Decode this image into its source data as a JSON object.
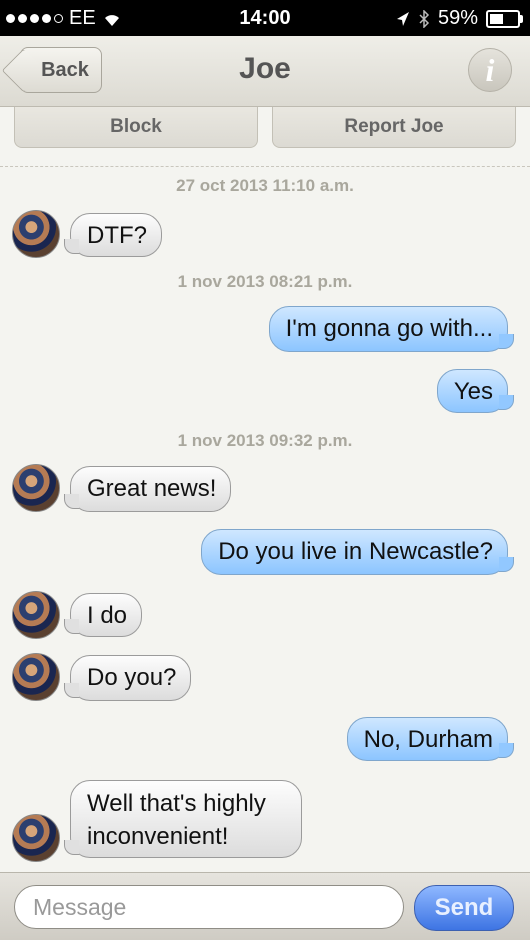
{
  "status_bar": {
    "carrier": "EE",
    "time": "14:00",
    "battery": "59%",
    "battery_level": 0.59
  },
  "nav": {
    "back_label": "Back",
    "title": "Joe",
    "info_label": "i"
  },
  "actions": {
    "block_label": "Block",
    "report_label": "Report Joe"
  },
  "messages": [
    {
      "type": "timestamp",
      "text": "27 oct 2013 11:10 a.m."
    },
    {
      "type": "in",
      "text": "DTF?"
    },
    {
      "type": "timestamp",
      "text": "1 nov 2013 08:21 p.m."
    },
    {
      "type": "out",
      "text": "I'm gonna go with..."
    },
    {
      "type": "out",
      "text": "Yes"
    },
    {
      "type": "timestamp",
      "text": "1 nov 2013 09:32 p.m."
    },
    {
      "type": "in",
      "text": "Great news!"
    },
    {
      "type": "out",
      "text": "Do you live in Newcastle?"
    },
    {
      "type": "in",
      "text": "I do"
    },
    {
      "type": "in",
      "text": "Do you?"
    },
    {
      "type": "out",
      "text": "No, Durham"
    },
    {
      "type": "in",
      "text": "Well that's highly inconvenient!"
    }
  ],
  "input": {
    "placeholder": "Message",
    "value": "",
    "send_label": "Send"
  }
}
